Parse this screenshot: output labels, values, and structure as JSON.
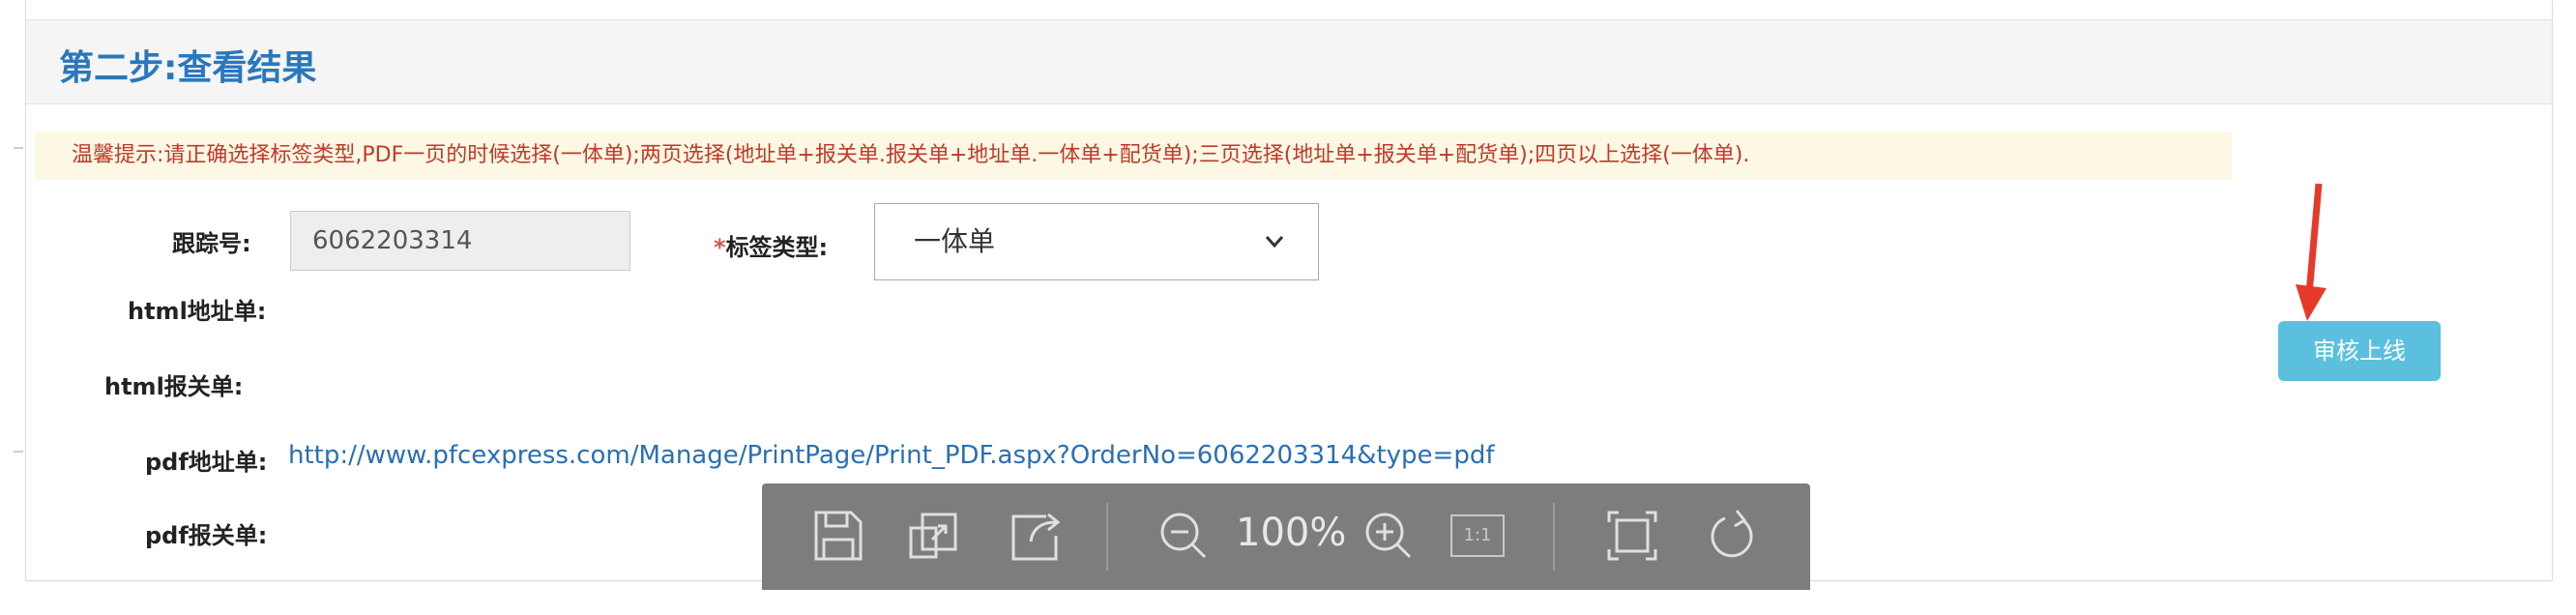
{
  "section": {
    "title": "第二步:查看结果"
  },
  "hint": {
    "text": "温馨提示:请正确选择标签类型,PDF一页的时候选择(一体单);两页选择(地址单+报关单.报关单+地址单.一体单+配货单);三页选择(地址单+报关单+配货单);四页以上选择(一体单)."
  },
  "form": {
    "tracking_label": "跟踪号:",
    "tracking_value": "6062203314",
    "label_type_required": "*",
    "label_type_label": "标签类型:",
    "label_type_selected": "一体单",
    "html_address_label": "html地址单:",
    "html_customs_label": "html报关单:",
    "pdf_address_label": "pdf地址单:",
    "pdf_address_link": "http://www.pfcexpress.com/Manage/PrintPage/Print_PDF.aspx?OrderNo=6062203314&type=pdf",
    "pdf_customs_label": "pdf报关单:"
  },
  "actions": {
    "review_online": "审核上线"
  },
  "pdf_toolbar": {
    "zoom": "100%",
    "icons": [
      "save-icon",
      "fit-page-icon",
      "share-icon",
      "zoom-out-icon",
      "zoom-in-icon",
      "actual-size-icon",
      "fullscreen-icon",
      "rotate-icon"
    ],
    "actual_size_label": "1:1"
  },
  "colors": {
    "title": "#2a77bd",
    "hint_bg": "#fcf8e3",
    "hint_text": "#c0392b",
    "button": "#5bc0de",
    "arrow": "#e53a2a",
    "toolbar_bg": "#7d7d7d"
  }
}
